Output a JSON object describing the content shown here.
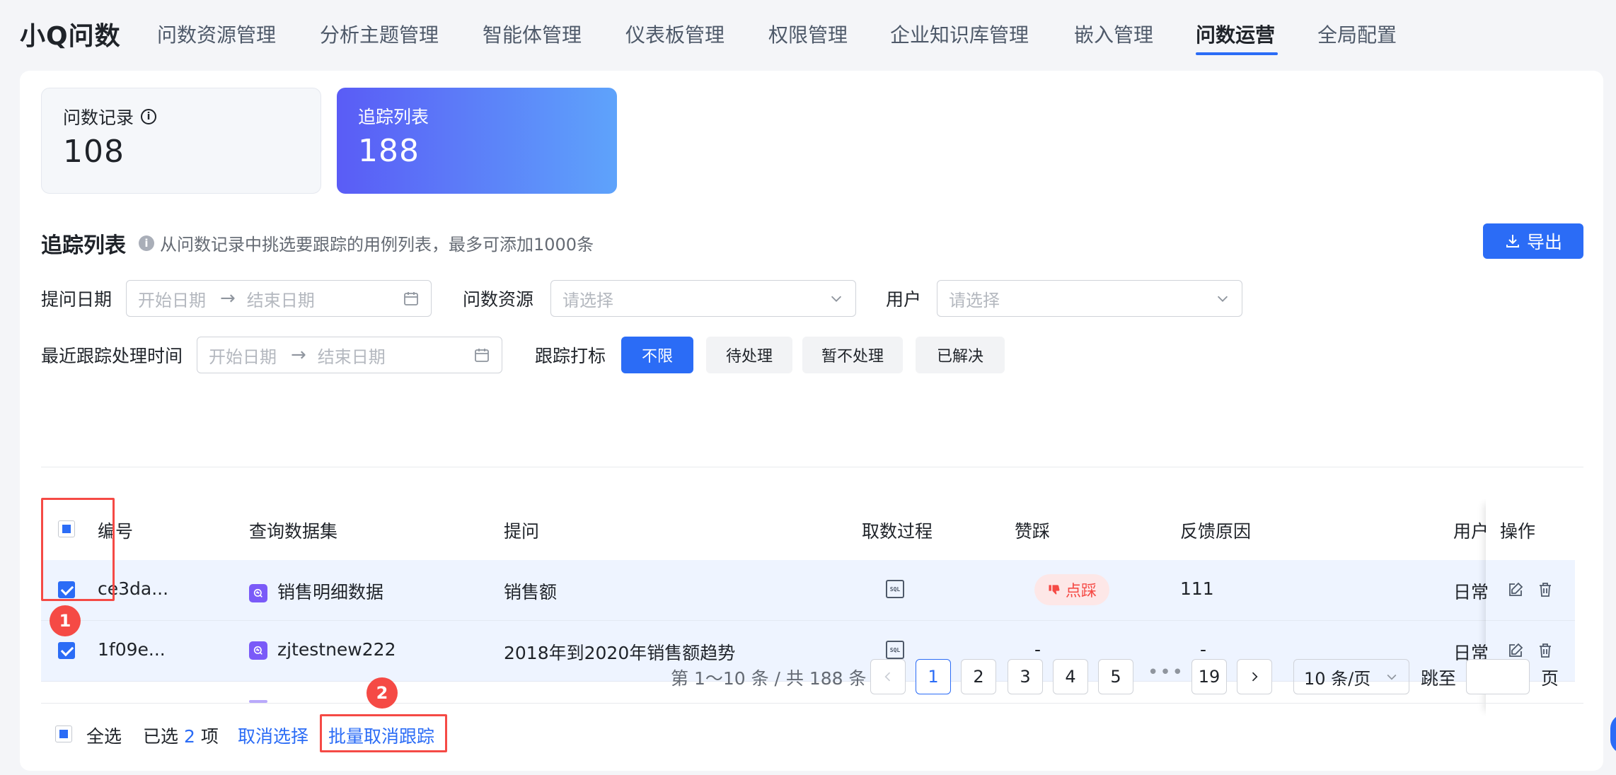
{
  "app": {
    "brand": "小Q问数"
  },
  "nav": {
    "items": [
      "问数资源管理",
      "分析主题管理",
      "智能体管理",
      "仪表板管理",
      "权限管理",
      "企业知识库管理",
      "嵌入管理",
      "问数运营",
      "全局配置"
    ],
    "active_index": 7
  },
  "stats": [
    {
      "label": "问数记录",
      "value": "108"
    },
    {
      "label": "追踪列表",
      "value": "188"
    }
  ],
  "section": {
    "title": "追踪列表",
    "hint": "从问数记录中挑选要跟踪的用例列表，最多可添加1000条",
    "export_label": "导出"
  },
  "filters": {
    "ask_date_label": "提问日期",
    "recent_time_label": "最近跟踪处理时间",
    "start_placeholder": "开始日期",
    "end_placeholder": "结束日期",
    "resource_label": "问数资源",
    "user_label": "用户",
    "select_placeholder": "请选择",
    "tag_label": "跟踪打标",
    "tag_options": [
      "不限",
      "待处理",
      "暂不处理",
      "已解决"
    ],
    "tag_selected": "不限"
  },
  "table": {
    "headers": [
      "编号",
      "查询数据集",
      "提问",
      "取数过程",
      "赞踩",
      "反馈原因",
      "用户",
      "操作"
    ],
    "rows": [
      {
        "id": "ce3da...",
        "dataset": "销售明细数据",
        "question": "销售额",
        "process": "SQL",
        "vote": "点踩",
        "reason": "111",
        "user": "日常"
      },
      {
        "id": "1f09e...",
        "dataset": "zjtestnew222",
        "question": "2018年到2020年销售额趋势",
        "process": "SQL",
        "vote": "-",
        "reason": "-",
        "user": "日常"
      }
    ]
  },
  "pagination": {
    "total_text": "第 1～10 条 / 共 188 条",
    "pages": [
      "1",
      "2",
      "3",
      "4",
      "5"
    ],
    "last_page": "19",
    "current": "1",
    "page_size": "10 条/页",
    "jump_label": "跳至",
    "page_suffix": "页"
  },
  "footer": {
    "select_all": "全选",
    "selected_prefix": "已选",
    "selected_count": "2",
    "selected_suffix": "项",
    "cancel_select": "取消选择",
    "batch_untrack": "批量取消跟踪"
  },
  "annotations": [
    "1",
    "2"
  ],
  "colors": {
    "primary": "#2b6cf6",
    "annotation_red": "#f54a45",
    "dataset_icon": "#7a5af8"
  }
}
